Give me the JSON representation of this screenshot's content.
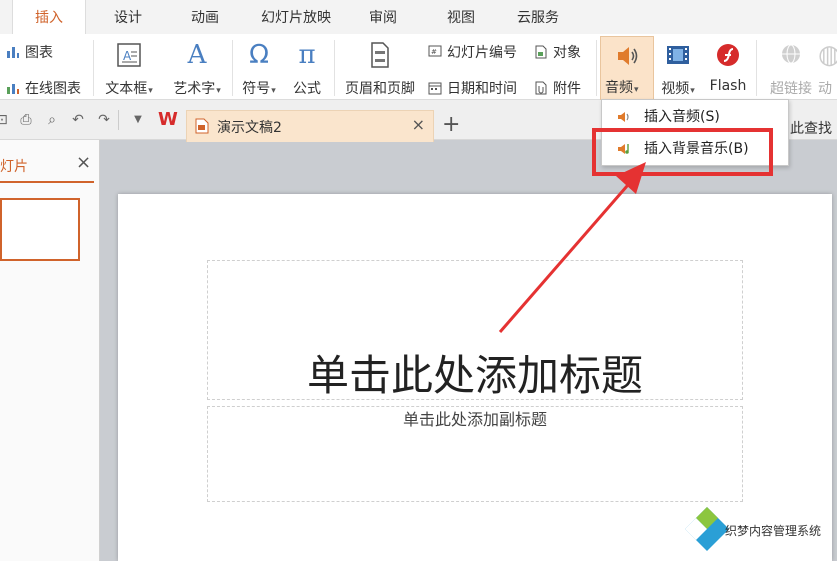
{
  "tabs": [
    {
      "label": "插入",
      "active": true
    },
    {
      "label": "设计"
    },
    {
      "label": "动画"
    },
    {
      "label": "幻灯片放映"
    },
    {
      "label": "审阅"
    },
    {
      "label": "视图"
    },
    {
      "label": "云服务"
    }
  ],
  "ribbon": {
    "chart": "图表",
    "online_chart": "在线图表",
    "textbox": "文本框",
    "wordart": "艺术字",
    "symbol": "符号",
    "formula": "公式",
    "header_footer": "页眉和页脚",
    "slide_number": "幻灯片编号",
    "object": "对象",
    "datetime": "日期和时间",
    "attachment": "附件",
    "audio": "音频",
    "video": "视频",
    "flash": "Flash",
    "hyperlink": "超链接",
    "animation_cut": "动"
  },
  "doc_tab": {
    "name": "演示文稿2"
  },
  "left_pane": {
    "title": "幻灯片"
  },
  "find_cut": "此查找",
  "audio_menu": {
    "items": [
      "插入音频(S)",
      "插入背景音乐(B)"
    ]
  },
  "slide": {
    "title_placeholder": "单击此处添加标题",
    "subtitle_placeholder": "单击此处添加副标题"
  },
  "watermark": {
    "text": "织梦内容管理系统"
  },
  "colors": {
    "accent": "#d0632b",
    "highlight": "#e53232",
    "doc_tab": "#fae5cd"
  }
}
